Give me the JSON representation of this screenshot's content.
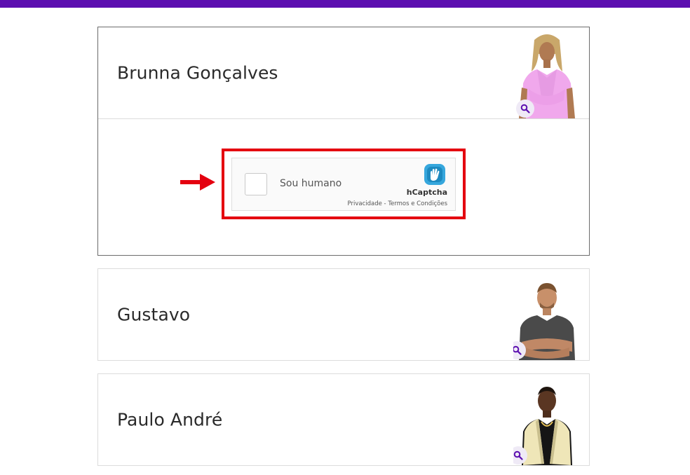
{
  "colors": {
    "topbar": "#5c0fb0",
    "highlight": "#e4000f",
    "accent": "#6a1ab0"
  },
  "participants": [
    {
      "name": "Brunna Gonçalves",
      "zoom_icon": "magnifier-icon"
    },
    {
      "name": "Gustavo",
      "zoom_icon": "magnifier-icon"
    },
    {
      "name": "Paulo André",
      "zoom_icon": "magnifier-icon"
    }
  ],
  "captcha": {
    "label": "Sou humano",
    "brand": "hCaptcha",
    "links": "Privacidade - Termos e Condições"
  },
  "annotation": {
    "arrow_icon": "red-arrow-right-icon",
    "highlight_color": "#e4000f"
  }
}
